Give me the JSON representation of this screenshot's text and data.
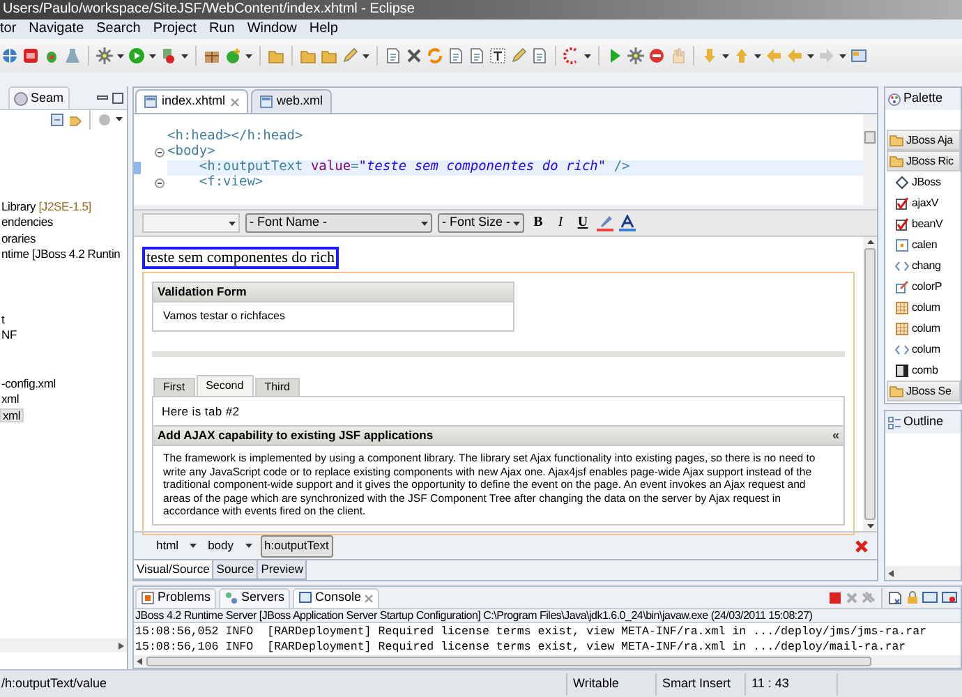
{
  "window": {
    "title": "Users/Paulo/workspace/SiteJSF/WebContent/index.xhtml - Eclipse"
  },
  "menu": [
    "tor",
    "Navigate",
    "Search",
    "Project",
    "Run",
    "Window",
    "Help"
  ],
  "left_panel": {
    "tab": "Seam",
    "tree": [
      {
        "label": "Library",
        "decoration": "[J2SE-1.5]",
        "selected": false
      },
      {
        "label": "endencies",
        "selected": false
      },
      {
        "label": "oraries",
        "selected": false
      },
      {
        "label": "ntime [JBoss 4.2 Runtin",
        "selected": false
      },
      {
        "label": "t",
        "selected": false
      },
      {
        "label": "NF",
        "selected": false
      },
      {
        "label": "-config.xml",
        "selected": false
      },
      {
        "label": "xml",
        "selected": false
      },
      {
        "label": "xml",
        "selected": true
      }
    ]
  },
  "editor": {
    "tabs": [
      {
        "label": "index.xhtml",
        "selected": true,
        "closable": true
      },
      {
        "label": "web.xml",
        "selected": false,
        "closable": false
      }
    ],
    "source_lines": [
      {
        "current": false,
        "fold": false,
        "tokens": [
          {
            "kind": "tag",
            "text": "<h:head></h:head>"
          }
        ]
      },
      {
        "current": false,
        "fold": true,
        "tokens": [
          {
            "kind": "tag",
            "text": "<body>"
          }
        ]
      },
      {
        "current": true,
        "fold": false,
        "tokens": [
          {
            "kind": "tag",
            "text": "    <h:outputText "
          },
          {
            "kind": "attr",
            "text": "value"
          },
          {
            "kind": "tag",
            "text": "="
          },
          {
            "kind": "string",
            "text": "\"teste sem componentes do rich\""
          },
          {
            "kind": "tag",
            "text": " />"
          }
        ]
      },
      {
        "current": false,
        "fold": true,
        "tokens": [
          {
            "kind": "tag",
            "text": "    <f:view>"
          }
        ]
      }
    ],
    "format_toolbar": {
      "font_name": "- Font Name -",
      "font_size": "- Font Size -",
      "buttons": [
        "B",
        "I",
        "U"
      ]
    },
    "visual": {
      "output_text": "teste sem componentes do rich",
      "panel": {
        "header": "Validation Form",
        "body": "Vamos testar o richfaces"
      },
      "tabs": [
        {
          "label": "First",
          "selected": false
        },
        {
          "label": "Second",
          "selected": true
        },
        {
          "label": "Third",
          "selected": false
        }
      ],
      "tab_content": "Here is tab #2",
      "toggle_panel": {
        "header": "Add AJAX capability to existing JSF applications",
        "toggle": "«",
        "body": "The framework is implemented by using a component library. The library set Ajax functionality into existing pages, so there is no need to write any JavaScript code or to replace existing components with new Ajax one. Ajax4jsf enables page-wide Ajax support instead of the traditional component-wide support and it gives the opportunity to define the event on the page. An event invokes an Ajax request and areas of the page which are synchronized with the JSF Component Tree after changing the data on the server by Ajax request in accordance with events fired on the client."
      }
    },
    "breadcrumb": [
      {
        "label": "html",
        "selected": false
      },
      {
        "label": "body",
        "selected": false
      },
      {
        "label": "h:outputText",
        "selected": true
      }
    ],
    "view_tabs": [
      {
        "label": "Visual/Source",
        "selected": true
      },
      {
        "label": "Source",
        "selected": false
      },
      {
        "label": "Preview",
        "selected": false
      }
    ]
  },
  "palette": {
    "title": "Palette",
    "groups": [
      {
        "label": "JBoss Aja"
      },
      {
        "label": "JBoss Ric",
        "children": [
          {
            "label": "JBoss",
            "kind": "tag"
          },
          {
            "label": "ajaxV",
            "kind": "check"
          },
          {
            "label": "beanV",
            "kind": "check"
          },
          {
            "label": "calen",
            "kind": "calendar"
          },
          {
            "label": "chang",
            "kind": "code"
          },
          {
            "label": "colorP",
            "kind": "picker"
          },
          {
            "label": "colum",
            "kind": "grid"
          },
          {
            "label": "colum",
            "kind": "grid"
          },
          {
            "label": "colum",
            "kind": "code"
          },
          {
            "label": "comb",
            "kind": "combo"
          }
        ]
      },
      {
        "label": "JBoss Se"
      }
    ]
  },
  "outline": {
    "title": "Outline"
  },
  "console": {
    "tabs": [
      {
        "label": "Problems",
        "selected": false
      },
      {
        "label": "Servers",
        "selected": false
      },
      {
        "label": "Console",
        "selected": true
      }
    ],
    "description": "JBoss 4.2 Runtime Server [JBoss Application Server Startup Configuration] C:\\Program Files\\Java\\jdk1.6.0_24\\bin\\javaw.exe (24/03/2011 15:08:27)",
    "lines": [
      "15:08:56,052 INFO  [RARDeployment] Required license terms exist, view META-INF/ra.xml in .../deploy/jms/jms-ra.rar",
      "15:08:56,106 INFO  [RARDeployment] Required license terms exist, view META-INF/ra.xml in .../deploy/mail-ra.rar"
    ]
  },
  "status_bar": {
    "path": "/h:outputText/value",
    "fields": [
      "Writable",
      "Smart Insert",
      "11 : 43"
    ]
  }
}
